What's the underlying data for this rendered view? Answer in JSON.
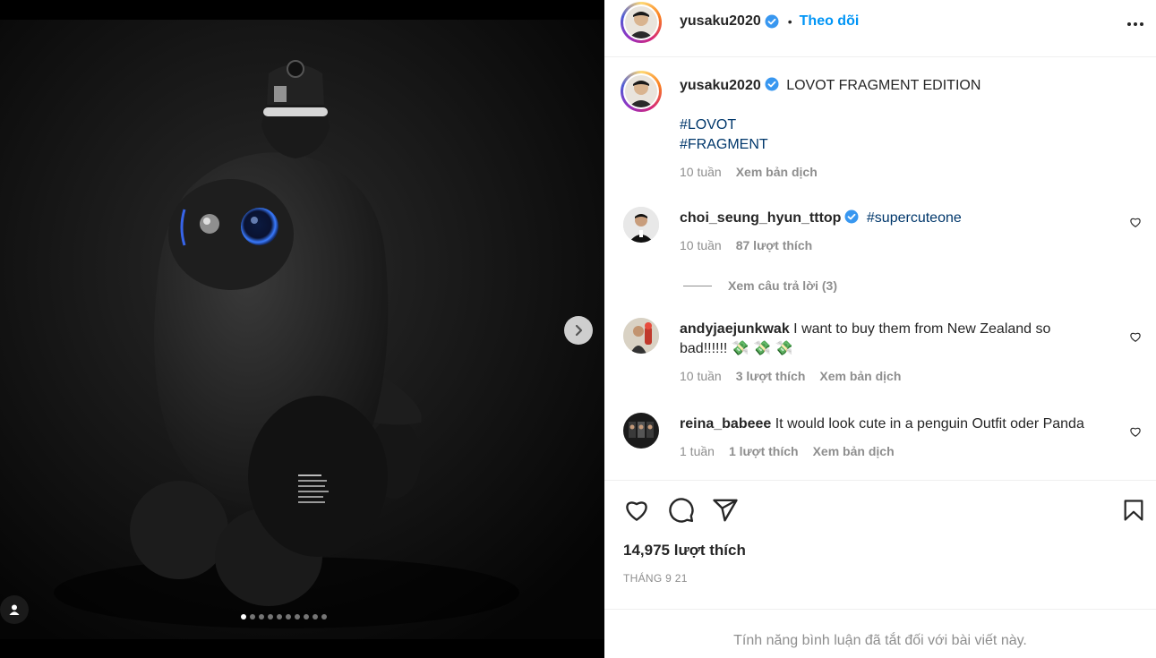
{
  "post": {
    "author": "yusaku2020",
    "follow_label": "Theo dõi",
    "separator": "•",
    "caption_title": "LOVOT FRAGMENT EDITION",
    "hashtags": [
      "#LOVOT",
      "#FRAGMENT"
    ],
    "caption_age": "10 tuần",
    "translate_label": "Xem bản dịch",
    "likes": "14,975 lượt thích",
    "date": "THÁNG 9 21",
    "comments_disabled": "Tính năng bình luận đã tắt đối với bài viết này.",
    "carousel": {
      "total": 10,
      "active": 1
    }
  },
  "comments": [
    {
      "user": "choi_seung_hyun_tttop",
      "verified": true,
      "text": "#supercuteone",
      "age": "10 tuần",
      "likes": "87 lượt thích",
      "replies_label": "Xem câu trả lời (3)"
    },
    {
      "user": "andyjaejunkwak",
      "verified": false,
      "text": "I want to buy them from New Zealand so bad!!!!!! 💸 💸 💸",
      "age": "10 tuần",
      "likes": "3 lượt thích",
      "translate": "Xem bản dịch"
    },
    {
      "user": "reina_babeee",
      "verified": false,
      "text": "It would look cute in a penguin Outfit oder Panda",
      "age": "1 tuần",
      "likes": "1 lượt thích",
      "translate": "Xem bản dịch"
    }
  ],
  "icons": {
    "more": "more-horizontal-icon",
    "verified": "verified-badge-icon",
    "heart": "heart-icon",
    "comment": "comment-icon",
    "share": "share-icon",
    "save": "bookmark-icon",
    "next": "chevron-right-icon",
    "tag": "user-tag-icon"
  },
  "colors": {
    "accent": "#0095f6",
    "hashtag": "#00376b",
    "muted": "#8e8e8e",
    "verified": "#3897f0"
  }
}
